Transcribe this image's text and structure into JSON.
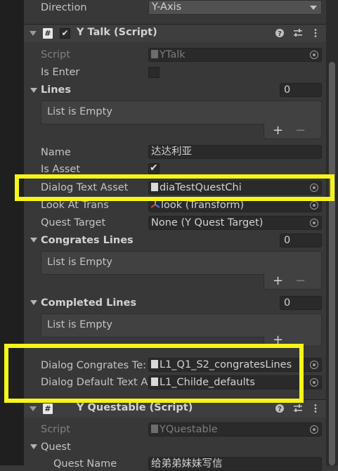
{
  "direction": {
    "label": "Direction",
    "value": "Y-Axis"
  },
  "ytalk": {
    "title": "Y Talk (Script)",
    "script_label": "Script",
    "script_value": "YTalk",
    "is_enter_label": "Is Enter",
    "is_enter_checked": false,
    "lines_label": "Lines",
    "lines_count": "0",
    "lines_empty": "List is Empty",
    "name_label": "Name",
    "name_value": "达达利亚",
    "is_asset_label": "Is Asset",
    "is_asset_checked": true,
    "dialog_text_asset_label": "Dialog Text Asset",
    "dialog_text_asset_value": "diaTestQuestChi",
    "look_at_trans_label": "Look At Trans",
    "look_at_trans_value": "look (Transform)",
    "quest_target_label": "Quest Target",
    "quest_target_value": "None (Y Quest Target)",
    "congrates_lines_label": "Congrates Lines",
    "congrates_lines_count": "0",
    "congrates_lines_empty": "List is Empty",
    "completed_lines_label": "Completed Lines",
    "completed_lines_count": "0",
    "completed_lines_empty": "List is Empty",
    "dialog_congrates_label": "Dialog Congrates Te:",
    "dialog_congrates_value": "L1_Q1_S2_congratesLines",
    "dialog_default_label": "Dialog Default Text A",
    "dialog_default_value": "L1_Childe_defaults"
  },
  "yquestable": {
    "title": "Y Questable (Script)",
    "script_label": "Script",
    "script_value": "YQuestable",
    "quest_label": "Quest",
    "quest_name_label": "Quest Name",
    "quest_name_value": "给弟弟妹妹写信"
  },
  "buttons": {
    "plus": "+",
    "minus": "−"
  },
  "icons": {
    "help": "question-circle-icon",
    "presets": "sliders-icon",
    "menu": "kebab-menu-icon"
  },
  "colors": {
    "highlight": "#f5f51a",
    "panel": "#383838",
    "field": "#2a2a2a"
  }
}
